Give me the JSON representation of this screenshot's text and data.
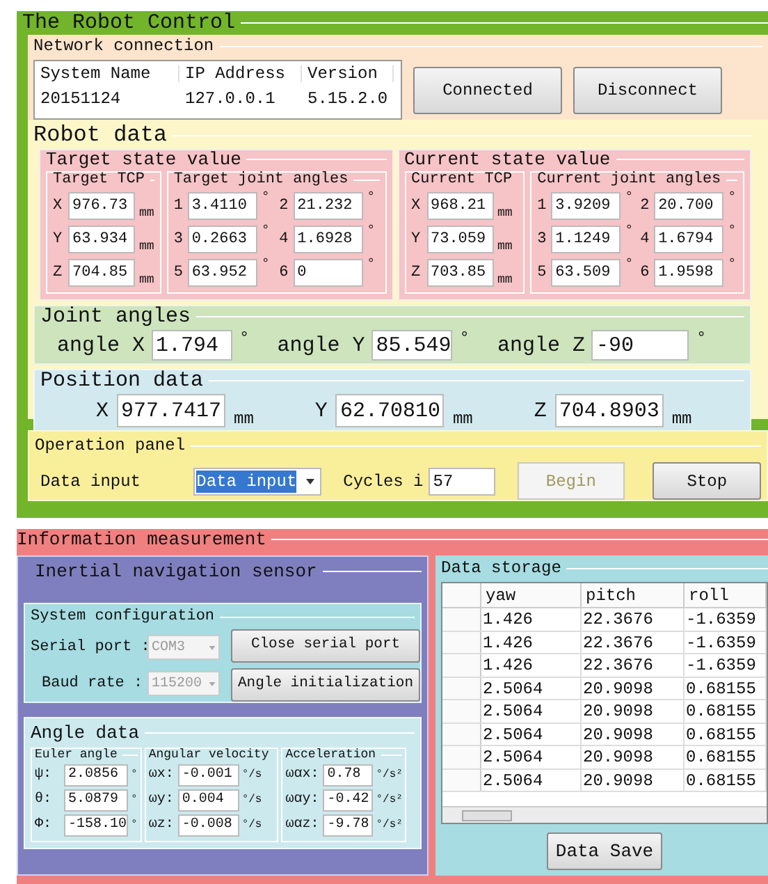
{
  "title": "The Robot Control",
  "network": {
    "title": "Network connection",
    "columns": [
      "System Name",
      "IP Address",
      "Version"
    ],
    "row": [
      "20151124",
      "127.0.0.1",
      "5.15.2.0"
    ],
    "buttons": [
      "Connected",
      "Disconnect"
    ]
  },
  "robot_data": {
    "title": "Robot data",
    "panels": [
      {
        "title": "Target state value",
        "tcp": {
          "title": "Target TCP",
          "fields": [
            {
              "label": "X",
              "value": "976.73",
              "unit": "mm"
            },
            {
              "label": "Y",
              "value": "63.934",
              "unit": "mm"
            },
            {
              "label": "Z",
              "value": "704.85",
              "unit": "mm"
            }
          ]
        },
        "joints": {
          "title": "Target joint angles",
          "fields": [
            {
              "label": "1",
              "value": "3.4110",
              "unit": "°"
            },
            {
              "label": "2",
              "value": "21.232",
              "unit": "°"
            },
            {
              "label": "3",
              "value": "0.2663",
              "unit": "°"
            },
            {
              "label": "4",
              "value": "1.6928",
              "unit": "°"
            },
            {
              "label": "5",
              "value": "63.952",
              "unit": "°"
            },
            {
              "label": "6",
              "value": "0",
              "unit": "°"
            }
          ]
        }
      },
      {
        "title": "Current state value",
        "tcp": {
          "title": "Current TCP",
          "fields": [
            {
              "label": "X",
              "value": "968.21",
              "unit": "mm"
            },
            {
              "label": "Y",
              "value": "73.059",
              "unit": "mm"
            },
            {
              "label": "Z",
              "value": "703.85",
              "unit": "mm"
            }
          ]
        },
        "joints": {
          "title": "Current joint angles",
          "fields": [
            {
              "label": "1",
              "value": "3.9209",
              "unit": "°"
            },
            {
              "label": "2",
              "value": "20.700",
              "unit": "°"
            },
            {
              "label": "3",
              "value": "1.1249",
              "unit": "°"
            },
            {
              "label": "4",
              "value": "1.6794",
              "unit": "°"
            },
            {
              "label": "5",
              "value": "63.509",
              "unit": "°"
            },
            {
              "label": "6",
              "value": "1.9598",
              "unit": "°"
            }
          ]
        }
      }
    ],
    "joint_angles": {
      "title": "Joint angles",
      "fields": [
        {
          "label": "angle X",
          "value": "1.794",
          "unit": "°"
        },
        {
          "label": "angle Y",
          "value": "85.549",
          "unit": "°"
        },
        {
          "label": "angle Z",
          "value": "-90",
          "unit": "°"
        }
      ]
    },
    "position": {
      "title": "Position data",
      "fields": [
        {
          "label": "X",
          "value": "977.7417",
          "unit": "mm"
        },
        {
          "label": "Y",
          "value": "62.70810",
          "unit": "mm"
        },
        {
          "label": "Z",
          "value": "704.8903",
          "unit": "mm"
        }
      ]
    }
  },
  "operation": {
    "title": "Operation panel",
    "label": "Data input",
    "dropdown": {
      "value": "Data input"
    },
    "cycles": {
      "label": "Cycles i",
      "value": "57"
    },
    "buttons": [
      {
        "label": "Begin",
        "disabled": true
      },
      {
        "label": "Stop",
        "disabled": false
      }
    ]
  },
  "info": {
    "title": "Information measurement",
    "sensor": {
      "title": "Inertial navigation sensor",
      "config": {
        "title": "System configuration",
        "selects": [
          {
            "label": "Serial port :",
            "value": "COM3",
            "disabled": true
          },
          {
            "label": "Baud rate :",
            "value": "115200",
            "disabled": true
          }
        ],
        "buttons": [
          "Close serial port",
          "Angle initialization"
        ]
      },
      "angle_data": {
        "title": "Angle data",
        "groups": [
          {
            "title": "Euler angle",
            "fields": [
              {
                "label": "ψ:",
                "value": "2.0856",
                "unit": "°"
              },
              {
                "label": "θ:",
                "value": "5.0879",
                "unit": "°"
              },
              {
                "label": "Φ:",
                "value": "-158.10",
                "unit": "°"
              }
            ]
          },
          {
            "title": "Angular velocity",
            "fields": [
              {
                "label": "ωx:",
                "value": "-0.001",
                "unit": "°/s"
              },
              {
                "label": "ωy:",
                "value": "0.004",
                "unit": "°/s"
              },
              {
                "label": "ωz:",
                "value": "-0.008",
                "unit": "°/s"
              }
            ]
          },
          {
            "title": "Acceleration",
            "fields": [
              {
                "label": "ωαx:",
                "value": "0.78",
                "unit": "°/s²"
              },
              {
                "label": "ωαy:",
                "value": "-0.42",
                "unit": "°/s²"
              },
              {
                "label": "ωαz:",
                "value": "-9.78",
                "unit": "°/s²"
              }
            ]
          }
        ]
      }
    },
    "storage": {
      "title": "Data storage",
      "columns": [
        "yaw",
        "pitch",
        "roll"
      ],
      "rows": [
        [
          "1.426",
          "22.3676",
          "-1.6359"
        ],
        [
          "1.426",
          "22.3676",
          "-1.6359"
        ],
        [
          "1.426",
          "22.3676",
          "-1.6359"
        ],
        [
          "2.5064",
          "20.9098",
          "0.68155"
        ],
        [
          "2.5064",
          "20.9098",
          "0.68155"
        ],
        [
          "2.5064",
          "20.9098",
          "0.68155"
        ],
        [
          "2.5064",
          "20.9098",
          "0.68155"
        ],
        [
          "2.5064",
          "20.9098",
          "0.68155"
        ]
      ],
      "button": "Data Save"
    }
  }
}
